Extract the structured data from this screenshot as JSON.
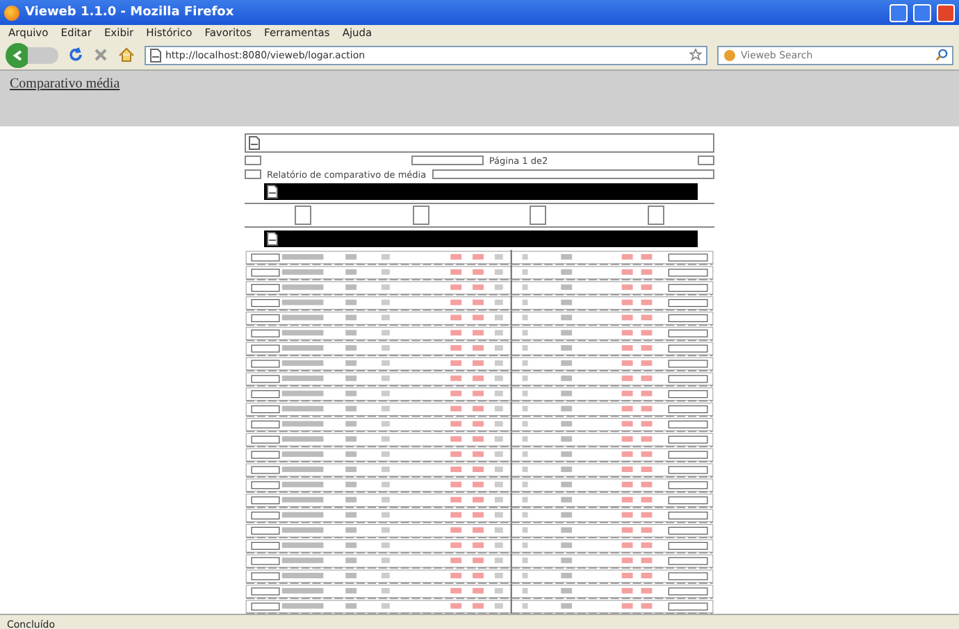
{
  "window": {
    "title": "Vieweb 1.1.0 - Mozilla Firefox"
  },
  "menu": [
    "Arquivo",
    "Editar",
    "Exibir",
    "Histórico",
    "Favoritos",
    "Ferramentas",
    "Ajuda"
  ],
  "address_bar": {
    "value": "http://localhost:8080/vieweb/logar.action"
  },
  "search": {
    "placeholder": "Vieweb Search"
  },
  "page_link": "Comparativo média",
  "report": {
    "page_info": "Página 1 de2",
    "title": "Relatório de comparativo de média"
  },
  "status_bar": "Concluído"
}
